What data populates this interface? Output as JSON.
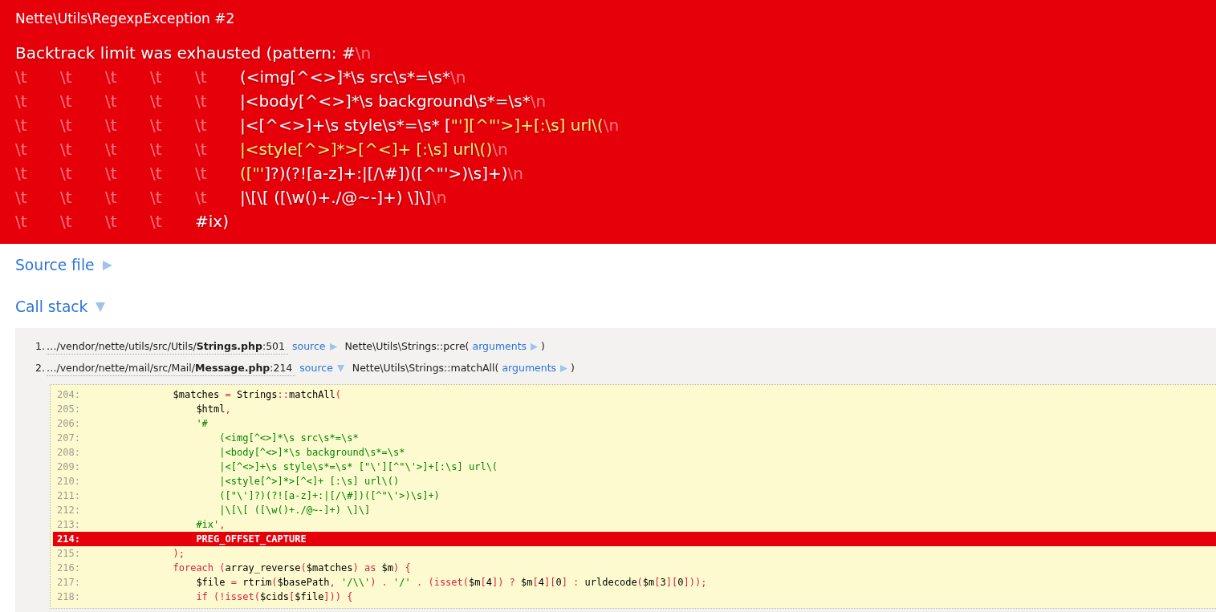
{
  "error": {
    "title": "Nette\\Utils\\RegexpException #2",
    "message_lines": [
      [
        {
          "kind": "plain",
          "text": "Backtrack limit was exhausted (pattern: #"
        },
        {
          "kind": "newline",
          "text": "\\n"
        }
      ],
      [
        {
          "kind": "tab",
          "text": "\\t"
        },
        {
          "kind": "tab",
          "text": "\\t"
        },
        {
          "kind": "tab",
          "text": "\\t"
        },
        {
          "kind": "tab",
          "text": "\\t"
        },
        {
          "kind": "tab",
          "text": "\\t"
        },
        {
          "kind": "plain",
          "text": "(<img[^<>]*\\s src\\s*=\\s*"
        },
        {
          "kind": "newline",
          "text": "\\n"
        }
      ],
      [
        {
          "kind": "tab",
          "text": "\\t"
        },
        {
          "kind": "tab",
          "text": "\\t"
        },
        {
          "kind": "tab",
          "text": "\\t"
        },
        {
          "kind": "tab",
          "text": "\\t"
        },
        {
          "kind": "tab",
          "text": "\\t"
        },
        {
          "kind": "plain",
          "text": "|<body[^<>]*\\s background\\s*=\\s*"
        },
        {
          "kind": "newline",
          "text": "\\n"
        }
      ],
      [
        {
          "kind": "tab",
          "text": "\\t"
        },
        {
          "kind": "tab",
          "text": "\\t"
        },
        {
          "kind": "tab",
          "text": "\\t"
        },
        {
          "kind": "tab",
          "text": "\\t"
        },
        {
          "kind": "tab",
          "text": "\\t"
        },
        {
          "kind": "plain",
          "text": "|<[^<>]+\\s style\\s*=\\s* ["
        },
        {
          "kind": "quoted",
          "text": "\"'][^\"'>]+[:\\s] url\\("
        },
        {
          "kind": "newline",
          "text": "\\n"
        }
      ],
      [
        {
          "kind": "tab",
          "text": "\\t"
        },
        {
          "kind": "tab",
          "text": "\\t"
        },
        {
          "kind": "tab",
          "text": "\\t"
        },
        {
          "kind": "tab",
          "text": "\\t"
        },
        {
          "kind": "tab",
          "text": "\\t"
        },
        {
          "kind": "quoted",
          "text": "|<style[^>]*>[^<]+ [:\\s] url\\()"
        },
        {
          "kind": "newline",
          "text": "\\n"
        }
      ],
      [
        {
          "kind": "tab",
          "text": "\\t"
        },
        {
          "kind": "tab",
          "text": "\\t"
        },
        {
          "kind": "tab",
          "text": "\\t"
        },
        {
          "kind": "tab",
          "text": "\\t"
        },
        {
          "kind": "tab",
          "text": "\\t"
        },
        {
          "kind": "quoted",
          "text": "([\"'"
        },
        {
          "kind": "plain",
          "text": "]?)(?![a-z]+:|[/\\#])([^\"'>)\\s]+)"
        },
        {
          "kind": "newline",
          "text": "\\n"
        }
      ],
      [
        {
          "kind": "tab",
          "text": "\\t"
        },
        {
          "kind": "tab",
          "text": "\\t"
        },
        {
          "kind": "tab",
          "text": "\\t"
        },
        {
          "kind": "tab",
          "text": "\\t"
        },
        {
          "kind": "tab",
          "text": "\\t"
        },
        {
          "kind": "plain",
          "text": "|\\[\\[ ([\\w()+./@~-]+) \\]\\]"
        },
        {
          "kind": "newline",
          "text": "\\n"
        }
      ],
      [
        {
          "kind": "tab",
          "text": "\\t"
        },
        {
          "kind": "tab",
          "text": "\\t"
        },
        {
          "kind": "tab",
          "text": "\\t"
        },
        {
          "kind": "tab",
          "text": "\\t"
        },
        {
          "kind": "plain",
          "text": "#ix)"
        }
      ]
    ]
  },
  "sections": [
    {
      "title": "Source file",
      "expanded": false
    },
    {
      "title": "Call stack",
      "expanded": true,
      "frames": [
        {
          "number": "1.",
          "file_link": "…/vendor/nette/utils/src/Utils/**Strings.php**:501",
          "source_label": "source",
          "source_expanded": false,
          "call": "Nette\\Utils\\Strings::pcre(",
          "arguments_label": "arguments",
          "arguments_expanded": false,
          "call_end": ")"
        },
        {
          "number": "2.",
          "file_link": "…/vendor/nette/mail/src/Mail/**Message.php**:214",
          "source_label": "source",
          "source_expanded": true,
          "call": "Nette\\Utils\\Strings::matchAll(",
          "arguments_label": "arguments",
          "arguments_expanded": false,
          "call_end": ")",
          "source_lines": [
            {
              "number": "204:",
              "highlighted": false,
              "tokens": [
                {
                  "kind": "default",
                  "text": "\t\t\t$matches"
                },
                {
                  "kind": "keyword",
                  "text": " = "
                },
                {
                  "kind": "default",
                  "text": "Strings"
                },
                {
                  "kind": "keyword",
                  "text": "::"
                },
                {
                  "kind": "default",
                  "text": "matchAll"
                },
                {
                  "kind": "keyword",
                  "text": "("
                }
              ]
            },
            {
              "number": "205:",
              "highlighted": false,
              "tokens": [
                {
                  "kind": "default",
                  "text": "\t\t\t\t$html"
                },
                {
                  "kind": "keyword",
                  "text": ","
                }
              ]
            },
            {
              "number": "206:",
              "highlighted": false,
              "tokens": [
                {
                  "kind": "string",
                  "text": "\t\t\t\t'#"
                }
              ]
            },
            {
              "number": "207:",
              "highlighted": false,
              "tokens": [
                {
                  "kind": "string",
                  "text": "\t\t\t\t\t(<img[^<>]*\\s src\\s*=\\s*"
                }
              ]
            },
            {
              "number": "208:",
              "highlighted": false,
              "tokens": [
                {
                  "kind": "string",
                  "text": "\t\t\t\t\t|<body[^<>]*\\s background\\s*=\\s*"
                }
              ]
            },
            {
              "number": "209:",
              "highlighted": false,
              "tokens": [
                {
                  "kind": "string",
                  "text": "\t\t\t\t\t|<[^<>]+\\s style\\s*=\\s* [\"\\'][^\"\\'>]+[:\\s] url\\("
                }
              ]
            },
            {
              "number": "210:",
              "highlighted": false,
              "tokens": [
                {
                  "kind": "string",
                  "text": "\t\t\t\t\t|<style[^>]*>[^<]+ [:\\s] url\\()"
                }
              ]
            },
            {
              "number": "211:",
              "highlighted": false,
              "tokens": [
                {
                  "kind": "string",
                  "text": "\t\t\t\t\t([\"\\']?)(?![a-z]+:|[/\\#])([^\"\\'>)\\s]+)"
                }
              ]
            },
            {
              "number": "212:",
              "highlighted": false,
              "tokens": [
                {
                  "kind": "string",
                  "text": "\t\t\t\t\t|\\[\\[ ([\\w()+./@~-]+) \\]\\]"
                }
              ]
            },
            {
              "number": "213:",
              "highlighted": false,
              "tokens": [
                {
                  "kind": "string",
                  "text": "\t\t\t\t#ix'"
                },
                {
                  "kind": "keyword",
                  "text": ","
                }
              ]
            },
            {
              "number": "214:",
              "highlighted": true,
              "tokens": [
                {
                  "kind": "default",
                  "text": "\t\t\t\tPREG_OFFSET_CAPTURE"
                }
              ]
            },
            {
              "number": "215:",
              "highlighted": false,
              "tokens": [
                {
                  "kind": "keyword",
                  "text": "\t\t\t);"
                }
              ]
            },
            {
              "number": "216:",
              "highlighted": false,
              "tokens": [
                {
                  "kind": "keyword",
                  "text": "\t\t\tforeach ("
                },
                {
                  "kind": "default",
                  "text": "array_reverse"
                },
                {
                  "kind": "keyword",
                  "text": "("
                },
                {
                  "kind": "default",
                  "text": "$matches"
                },
                {
                  "kind": "keyword",
                  "text": ") as "
                },
                {
                  "kind": "default",
                  "text": "$m"
                },
                {
                  "kind": "keyword",
                  "text": ") {"
                }
              ]
            },
            {
              "number": "217:",
              "highlighted": false,
              "tokens": [
                {
                  "kind": "default",
                  "text": "\t\t\t\t$file"
                },
                {
                  "kind": "keyword",
                  "text": " = "
                },
                {
                  "kind": "default",
                  "text": "rtrim"
                },
                {
                  "kind": "keyword",
                  "text": "("
                },
                {
                  "kind": "default",
                  "text": "$basePath"
                },
                {
                  "kind": "keyword",
                  "text": ", "
                },
                {
                  "kind": "string",
                  "text": "'/\\\\'"
                },
                {
                  "kind": "keyword",
                  "text": ") . "
                },
                {
                  "kind": "string",
                  "text": "'/'"
                },
                {
                  "kind": "keyword",
                  "text": " . (isset("
                },
                {
                  "kind": "default",
                  "text": "$m"
                },
                {
                  "kind": "keyword",
                  "text": "["
                },
                {
                  "kind": "default",
                  "text": "4"
                },
                {
                  "kind": "keyword",
                  "text": "]) ? "
                },
                {
                  "kind": "default",
                  "text": "$m"
                },
                {
                  "kind": "keyword",
                  "text": "["
                },
                {
                  "kind": "default",
                  "text": "4"
                },
                {
                  "kind": "keyword",
                  "text": "]["
                },
                {
                  "kind": "default",
                  "text": "0"
                },
                {
                  "kind": "keyword",
                  "text": "] : "
                },
                {
                  "kind": "default",
                  "text": "urldecode"
                },
                {
                  "kind": "keyword",
                  "text": "("
                },
                {
                  "kind": "default",
                  "text": "$m"
                },
                {
                  "kind": "keyword",
                  "text": "["
                },
                {
                  "kind": "default",
                  "text": "3"
                },
                {
                  "kind": "keyword",
                  "text": "]["
                },
                {
                  "kind": "default",
                  "text": "0"
                },
                {
                  "kind": "keyword",
                  "text": "]));"
                }
              ]
            },
            {
              "number": "218:",
              "highlighted": false,
              "tokens": [
                {
                  "kind": "keyword",
                  "text": "\t\t\t\tif (!isset("
                },
                {
                  "kind": "default",
                  "text": "$cids"
                },
                {
                  "kind": "keyword",
                  "text": "["
                },
                {
                  "kind": "default",
                  "text": "$file"
                },
                {
                  "kind": "keyword",
                  "text": "])) {"
                }
              ]
            }
          ]
        }
      ]
    }
  ]
}
